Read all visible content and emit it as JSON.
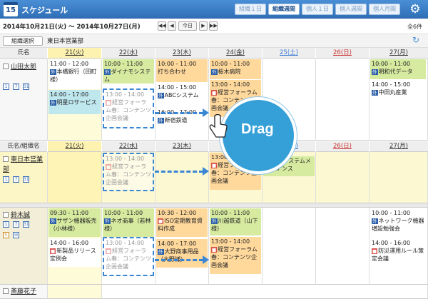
{
  "app": {
    "icon_day": "15",
    "title": "スケジュール"
  },
  "views": [
    {
      "label": "組織１日",
      "active": false
    },
    {
      "label": "組織週間",
      "active": true
    },
    {
      "label": "個人１日",
      "active": false
    },
    {
      "label": "個人週間",
      "active": false
    },
    {
      "label": "個人月間",
      "active": false
    }
  ],
  "nav": {
    "range": "2014年10月21日(火) ～ 2014年10月27日(月)",
    "today": "今日",
    "count": "全6件"
  },
  "org": {
    "select_label": "組織選択",
    "name": "東日本営業部"
  },
  "columns": {
    "name": "氏名",
    "name_group": "氏名/組織名",
    "days": [
      "21(火)",
      "22(水)",
      "23(木)",
      "24(金)",
      "25(土)",
      "26(日)",
      "27(月)"
    ]
  },
  "rows": {
    "p1": "山田太郎",
    "g1": "東日本営業部",
    "p2": "鈴木誠",
    "p3": "斎藤花子"
  },
  "events": {
    "e1": {
      "time": "11:00 - 12:00",
      "tag": "外",
      "text": "本橋銀行（田町様）"
    },
    "e2": {
      "time": "14:00 - 17:00",
      "tag": "外",
      "text": "明星ロサービス"
    },
    "e3": {
      "time": "10:00 - 11:00",
      "tag": "外",
      "text": "ダイナモシステム"
    },
    "e4": {
      "time": "13:00 - 14:00",
      "tag": "",
      "text": "経営フォーラム春：コンテンツ企画会議"
    },
    "e5": {
      "time": "10:00 - 11:00",
      "tag": "",
      "text": "打ち合わせ"
    },
    "e6": {
      "time": "14:00 - 15:00",
      "tag": "外",
      "text": "ABCシステム"
    },
    "e7": {
      "time": "16:00 - 17:00",
      "tag": "外",
      "text": "新宿鉄道"
    },
    "e8": {
      "time": "10:00 - 11:00",
      "tag": "外",
      "text": "桜木病院"
    },
    "e9": {
      "time": "13:00 - 14:00",
      "tag": "",
      "text": "経営フォーラム春：コンテンツ企画会議"
    },
    "e10": {
      "time": "10:00 - 11:00",
      "tag": "外",
      "text": "明和代データ"
    },
    "e11": {
      "time": "14:00 - 15:00",
      "tag": "外",
      "text": "中田丸産業"
    },
    "e12": {
      "time": "13:00 - 14:00",
      "tag": "",
      "text": "経営フォーラム春：コンテンツ企画会議"
    },
    "e13": {
      "time": "13:00 - 14:00",
      "tag": "",
      "text": "経営フォーラム春：コンテンツ企画会議"
    },
    "e14": {
      "time": "",
      "tag": "",
      "text": "業務システムメンテナンス"
    },
    "e15": {
      "time": "09:30 - 11:00",
      "tag": "外",
      "text": "サザン機器販売（小林様）"
    },
    "e16": {
      "time": "14:00 - 16:00",
      "tag": "",
      "text": "新製品リリース定例会"
    },
    "e17": {
      "time": "10:00 - 11:00",
      "tag": "外",
      "text": "ネオ商事（若林様）"
    },
    "e18": {
      "time": "13:00 - 14:00",
      "tag": "",
      "text": "経営フォーラム春：コンテンツ企画会議"
    },
    "e19": {
      "time": "10:30 - 12:00",
      "tag": "",
      "text": "ISO定期教育資料作成"
    },
    "e20": {
      "time": "14:00 - 17:00",
      "tag": "外",
      "text": "大野商事用品（大野様）"
    },
    "e21": {
      "time": "10:00 - 11:00",
      "tag": "外",
      "text": "川越鉄道（山下様）"
    },
    "e22": {
      "time": "13:00 - 14:00",
      "tag": "",
      "text": "経営フォーラム春：コンテンツ企画会議"
    },
    "e23": {
      "time": "10:00 - 11:00",
      "tag": "外",
      "text": "ネットワーク機器増設勉強会"
    },
    "e24": {
      "time": "14:00 - 16:00",
      "tag": "",
      "text": "防災運用ルール策定会議"
    }
  },
  "drag_label": "Drag",
  "colors": {
    "header_blue": "#2f6fb8",
    "today": "#fefbd9",
    "drag_blue": "#35a0d8"
  }
}
